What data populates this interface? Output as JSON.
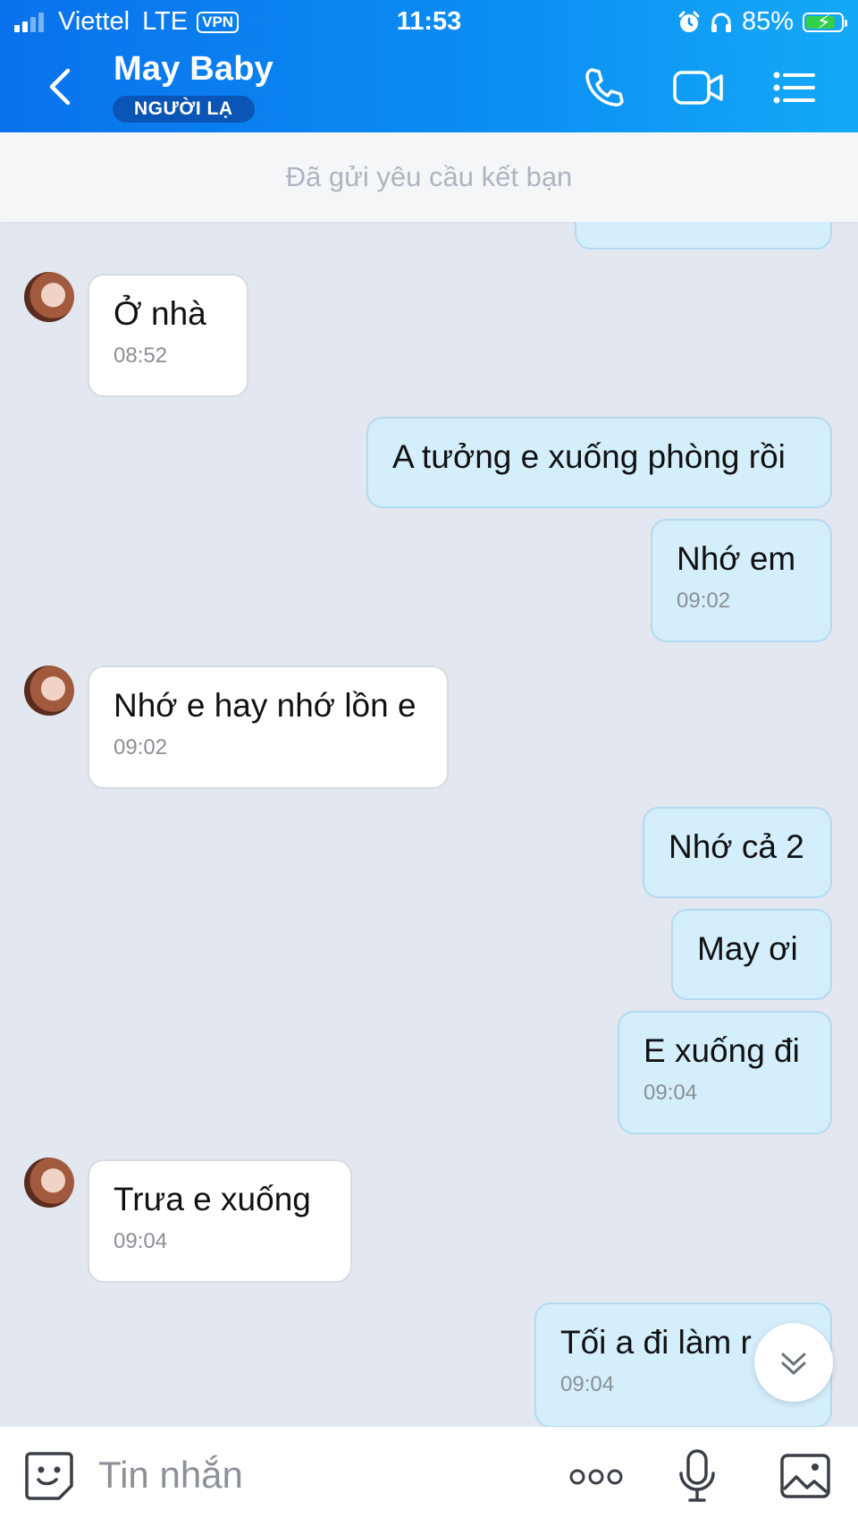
{
  "status_bar": {
    "carrier": "Viettel",
    "network": "LTE",
    "vpn": "VPN",
    "time": "11:53",
    "battery": "85%",
    "battery_level": 0.85
  },
  "header": {
    "contact_name": "May Baby",
    "contact_badge": "NGƯỜI LẠ",
    "icons": [
      "back-icon",
      "phone-icon",
      "video-icon",
      "menu-icon"
    ]
  },
  "notice": "Đã gửi yêu cầu kết bạn",
  "messages": [
    {
      "side": "in",
      "text": "Ở nhà",
      "time": "08:52"
    },
    {
      "side": "out",
      "text": "A tưởng e xuống phòng rồi",
      "time": ""
    },
    {
      "side": "out",
      "text": "Nhớ em",
      "time": "09:02"
    },
    {
      "side": "in",
      "text": "Nhớ e hay nhớ lồn e",
      "time": "09:02"
    },
    {
      "side": "out",
      "text": "Nhớ cả 2",
      "time": ""
    },
    {
      "side": "out",
      "text": "May ơi",
      "time": ""
    },
    {
      "side": "out",
      "text": "E xuống đi",
      "time": "09:04"
    },
    {
      "side": "in",
      "text": "Trưa e xuống",
      "time": "09:04"
    },
    {
      "side": "out",
      "text": "Tối a đi làm r",
      "time": "09:04"
    }
  ],
  "composer": {
    "placeholder": "Tin nhắn",
    "icons": [
      "sticker-icon",
      "more-icon",
      "microphone-icon",
      "image-icon"
    ]
  },
  "colors": {
    "header_gradient_start": "#0a72ec",
    "header_gradient_end": "#14a9f8",
    "chat_background": "#e2e7f0",
    "outgoing_bubble": "#d4eefc",
    "incoming_bubble": "#ffffff"
  }
}
